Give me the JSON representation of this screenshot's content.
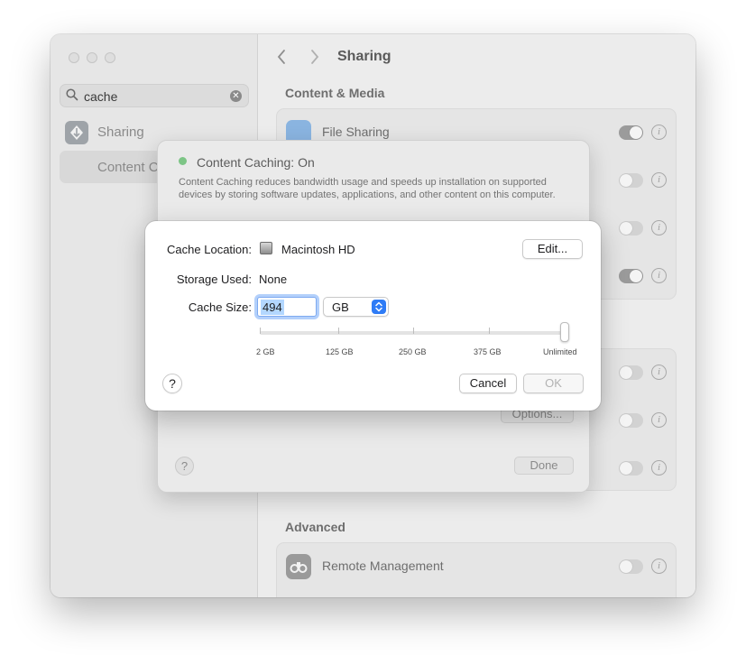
{
  "sidebar": {
    "search_value": "cache",
    "items": [
      {
        "label": "Sharing"
      },
      {
        "label": "Content C"
      }
    ]
  },
  "toolbar": {
    "title": "Sharing"
  },
  "sections": {
    "content_media": "Content & Media",
    "advanced": "Advanced"
  },
  "rows": {
    "file_sharing": {
      "label": "File Sharing",
      "on": true
    },
    "remote_management": {
      "label": "Remote Management",
      "on": false
    }
  },
  "sheet": {
    "title": "Content Caching: On",
    "description": "Content Caching reduces bandwidth usage and speeds up installation on supported devices by storing software updates, applications, and other content on this computer.",
    "options_label": "Options...",
    "done_label": "Done",
    "help_label": "?",
    "status_color": "#7dc586"
  },
  "dialog": {
    "cache_location_label": "Cache Location:",
    "cache_location_value": "Macintosh HD",
    "edit_label": "Edit...",
    "storage_used_label": "Storage Used:",
    "storage_used_value": "None",
    "cache_size_label": "Cache Size:",
    "cache_size_value": "494",
    "unit_value": "GB",
    "slider_ticks": [
      "2 GB",
      "125 GB",
      "250 GB",
      "375 GB",
      "Unlimited"
    ],
    "slider_position": "Unlimited",
    "help_label": "?",
    "cancel_label": "Cancel",
    "ok_label": "OK",
    "accent_color": "#2f7cf6"
  }
}
